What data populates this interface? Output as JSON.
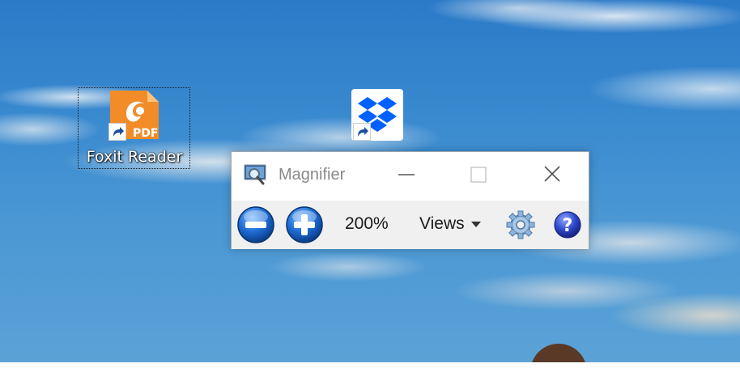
{
  "desktop": {
    "icons": [
      {
        "label": "Foxit Reader",
        "icon": "foxit-reader-icon",
        "color": "#f28c28",
        "selected": true
      },
      {
        "label": "",
        "icon": "dropbox-icon",
        "color": "#0061fe",
        "selected": false
      }
    ]
  },
  "magnifier": {
    "title": "Magnifier",
    "window_buttons": {
      "minimize": "minimize-icon",
      "maximize": "maximize-icon",
      "close": "close-icon"
    },
    "zoom_out_icon": "zoom-out-icon",
    "zoom_in_icon": "zoom-in-icon",
    "zoom_level": "200%",
    "views_label": "Views",
    "settings_icon": "gear-icon",
    "help_icon": "help-icon",
    "accent_color": "#1f6fd6"
  }
}
